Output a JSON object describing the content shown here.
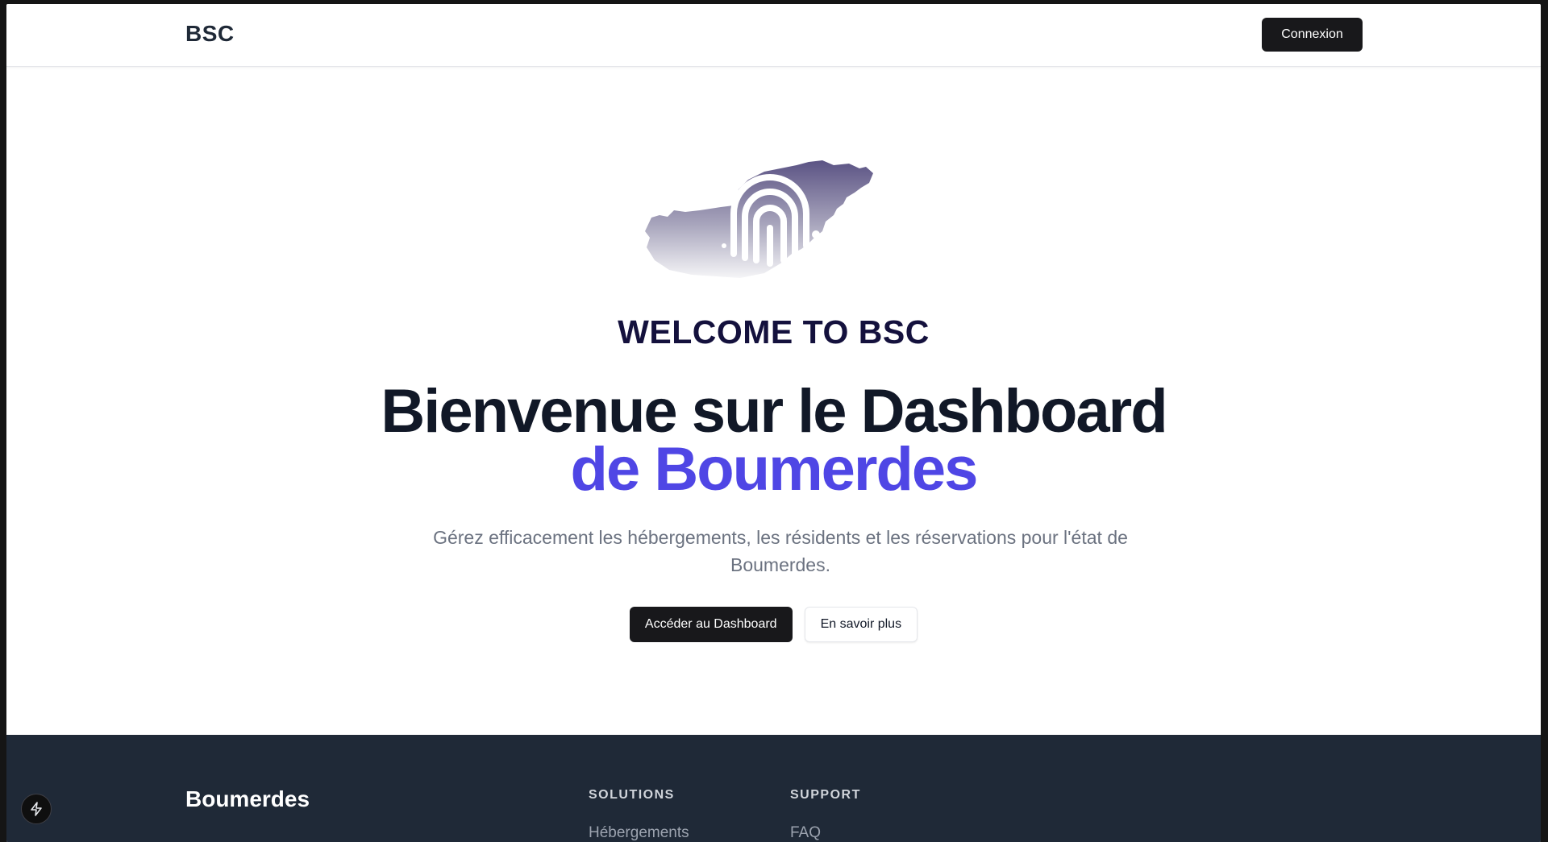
{
  "header": {
    "brand": "BSC",
    "login_label": "Connexion"
  },
  "hero": {
    "eyebrow": "WELCOME TO BSC",
    "headline_line1": "Bienvenue sur le Dashboard",
    "headline_line2": "de Boumerdes",
    "subtitle": "Gérez efficacement les hébergements, les résidents et les réservations pour l'état de Boumerdes.",
    "primary_cta": "Accéder au Dashboard",
    "secondary_cta": "En savoir plus"
  },
  "footer": {
    "brand": "Boumerdes",
    "columns": [
      {
        "title": "SOLUTIONS",
        "links": [
          "Hébergements"
        ]
      },
      {
        "title": "SUPPORT",
        "links": [
          "FAQ"
        ]
      }
    ]
  },
  "icons": {
    "logo": "boumerdes-map-logo-icon",
    "dev_badge": "bolt-icon"
  },
  "colors": {
    "accent": "#4f46e5",
    "eyebrow": "#14113d",
    "footer_bg": "#1f2937",
    "button_dark": "#18181b"
  }
}
